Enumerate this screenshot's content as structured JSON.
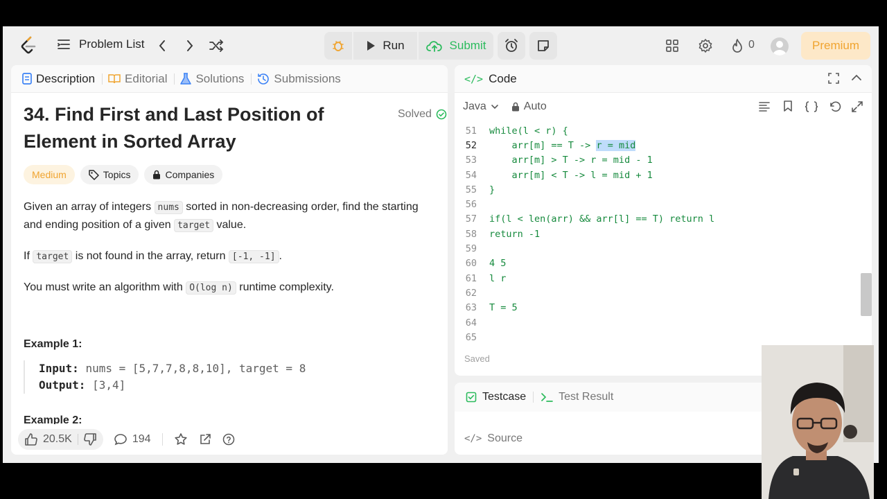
{
  "nav": {
    "problem_list": "Problem List",
    "run": "Run",
    "submit": "Submit",
    "streak": "0",
    "premium": "Premium"
  },
  "left_tabs": [
    {
      "label": "Description",
      "icon": "description-icon"
    },
    {
      "label": "Editorial",
      "icon": "book-icon"
    },
    {
      "label": "Solutions",
      "icon": "flask-icon"
    },
    {
      "label": "Submissions",
      "icon": "history-icon"
    }
  ],
  "problem": {
    "title": "34. Find First and Last Position of Element in Sorted Array",
    "status": "Solved",
    "difficulty": "Medium",
    "topics": "Topics",
    "companies": "Companies",
    "desc1_a": "Given an array of integers ",
    "desc1_code1": "nums",
    "desc1_b": " sorted in non-decreasing order, find the starting and ending position of a given ",
    "desc1_code2": "target",
    "desc1_c": " value.",
    "desc2_a": "If ",
    "desc2_code1": "target",
    "desc2_b": " is not found in the array, return ",
    "desc2_code2": "[-1, -1]",
    "desc2_c": ".",
    "desc3_a": "You must write an algorithm with ",
    "desc3_code": "O(log n)",
    "desc3_b": " runtime complexity.",
    "example1_title": "Example 1:",
    "input_label": "Input:",
    "input_value": "nums = [5,7,7,8,8,10], target = 8",
    "output_label": "Output:",
    "output_value": "[3,4]",
    "example2_title": "Example 2:"
  },
  "footer": {
    "likes": "20.5K",
    "comments": "194"
  },
  "code": {
    "header": "Code",
    "language": "Java",
    "mode": "Auto",
    "saved": "Saved",
    "lines": [
      {
        "n": "51",
        "text": "while(l < r) {"
      },
      {
        "n": "52",
        "pre": "    arr[m] == T -> ",
        "hl": "r = mid"
      },
      {
        "n": "53",
        "text": "    arr[m] > T -> r = mid - 1"
      },
      {
        "n": "54",
        "text": "    arr[m] < T -> l = mid + 1"
      },
      {
        "n": "55",
        "text": "}"
      },
      {
        "n": "56",
        "text": ""
      },
      {
        "n": "57",
        "text": "if(l < len(arr) && arr[l] == T) return l"
      },
      {
        "n": "58",
        "text": "return -1"
      },
      {
        "n": "59",
        "text": ""
      },
      {
        "n": "60",
        "text": "4 5"
      },
      {
        "n": "61",
        "text": "l r"
      },
      {
        "n": "62",
        "text": ""
      },
      {
        "n": "63",
        "text": "T = 5"
      },
      {
        "n": "64",
        "text": ""
      },
      {
        "n": "65",
        "text": ""
      }
    ]
  },
  "test": {
    "testcase": "Testcase",
    "result": "Test Result",
    "source": "Source"
  },
  "colors": {
    "accent_green": "#2cbb5d",
    "medium": "#f0a430",
    "code_green": "#168a3d"
  }
}
